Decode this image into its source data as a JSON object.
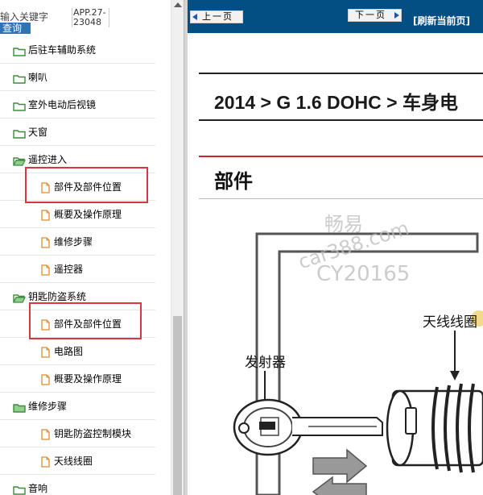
{
  "search": {
    "placeholder_text": "输入关键字",
    "app_id": "APP.27-23048",
    "query_label": "查询"
  },
  "tree": [
    {
      "label": "后驻车辅助系统",
      "type": "folder"
    },
    {
      "label": "喇叭",
      "type": "folder"
    },
    {
      "label": "室外电动后视镜",
      "type": "folder"
    },
    {
      "label": "天窗",
      "type": "folder"
    },
    {
      "label": "遥控进入",
      "type": "folder-open"
    },
    {
      "label": "部件及部件位置",
      "type": "doc",
      "highlighted": true
    },
    {
      "label": "概要及操作原理",
      "type": "doc"
    },
    {
      "label": "维修步骤",
      "type": "doc"
    },
    {
      "label": "遥控器",
      "type": "doc"
    },
    {
      "label": "钥匙防盗系统",
      "type": "folder-open"
    },
    {
      "label": "部件及部件位置",
      "type": "doc",
      "highlighted": true
    },
    {
      "label": "电路图",
      "type": "doc"
    },
    {
      "label": "概要及操作原理",
      "type": "doc"
    },
    {
      "label": "维修步骤",
      "type": "folder"
    },
    {
      "label": "钥匙防盗控制模块",
      "type": "doc"
    },
    {
      "label": "天线线圈",
      "type": "doc"
    },
    {
      "label": "音响",
      "type": "folder"
    }
  ],
  "toolbar": {
    "prev_label": "上一页",
    "next_label": "下一页",
    "refresh_label": "[刷新当前页]"
  },
  "content": {
    "breadcrumb": "2014 > G 1.6 DOHC > 车身电",
    "section_title": "部件",
    "watermark": {
      "line1": "畅易",
      "line2": "car388.com",
      "line3": "CY20165"
    },
    "diagram_labels": {
      "antenna": "天线线圈",
      "transmitter": "发射器"
    }
  },
  "colors": {
    "toolbar_bg": "#034f84",
    "query_btn": "#2f74b5",
    "highlight": "#d9363e",
    "red_rule": "#c12a2a"
  }
}
